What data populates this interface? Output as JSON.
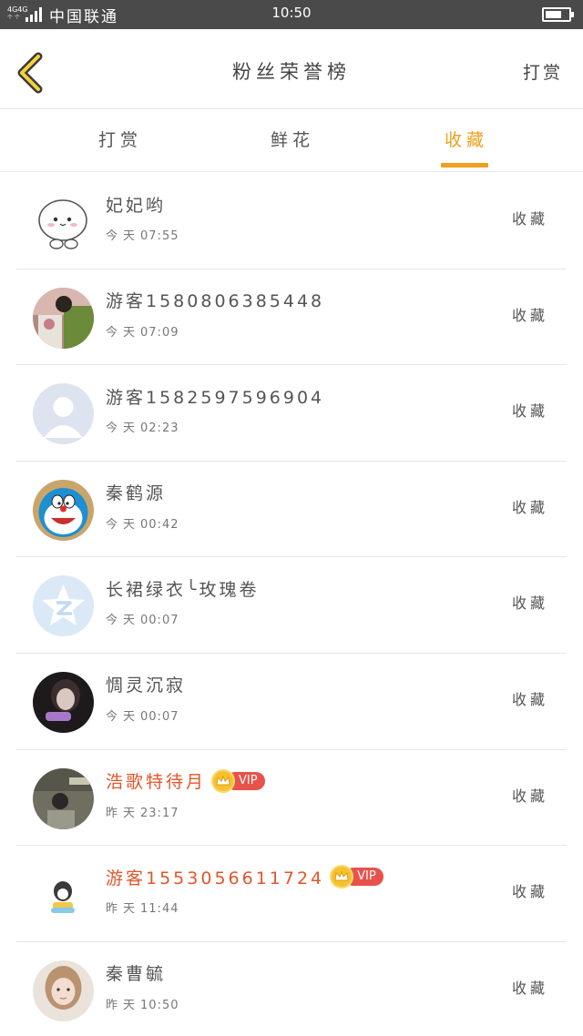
{
  "status_bar": {
    "network": "4G4G",
    "network_sub": "个 个",
    "carrier": "中国联通",
    "time": "10:50",
    "battery_level": 0.7
  },
  "header": {
    "back_icon": "chevron-left-icon",
    "title": "粉丝荣誉榜",
    "action": "打赏"
  },
  "tabs": [
    {
      "label": "打赏",
      "active": false
    },
    {
      "label": "鲜花",
      "active": false
    },
    {
      "label": "收藏",
      "active": true
    }
  ],
  "colors": {
    "accent": "#f0a01e",
    "vip_name": "#e2562a",
    "vip_badge": "#e8524c",
    "crown": "#f6c12e",
    "status_bar": "#4a4a4a"
  },
  "vip_label": "VIP",
  "rows": [
    {
      "name": "妃妃哟",
      "day": "今天",
      "time": "07:55",
      "action": "收藏",
      "vip": false,
      "avatar": "cartoon-bun-avatar"
    },
    {
      "name": "游客1580806385448",
      "day": "今天",
      "time": "07:09",
      "action": "收藏",
      "vip": false,
      "avatar": "photo-avatar"
    },
    {
      "name": "游客1582597596904",
      "day": "今天",
      "time": "02:23",
      "action": "收藏",
      "vip": false,
      "avatar": "default-user-avatar"
    },
    {
      "name": "秦鹤源",
      "day": "今天",
      "time": "00:42",
      "action": "收藏",
      "vip": false,
      "avatar": "doraemon-avatar"
    },
    {
      "name": "长裙绿衣╰玫瑰卷",
      "day": "今天",
      "time": "00:07",
      "action": "收藏",
      "vip": false,
      "avatar": "qq-logo-avatar"
    },
    {
      "name": "惆灵沉寂",
      "day": "今天",
      "time": "00:07",
      "action": "收藏",
      "vip": false,
      "avatar": "dark-photo-avatar"
    },
    {
      "name": "浩歌特待月",
      "day": "昨天",
      "time": "23:17",
      "action": "收藏",
      "vip": true,
      "avatar": "photo-avatar"
    },
    {
      "name": "游客1553056611724",
      "day": "昨天",
      "time": "11:44",
      "action": "收藏",
      "vip": true,
      "avatar": "penguin-avatar"
    },
    {
      "name": "秦曹毓",
      "day": "昨天",
      "time": "10:50",
      "action": "收藏",
      "vip": false,
      "avatar": "girl-photo-avatar"
    }
  ]
}
